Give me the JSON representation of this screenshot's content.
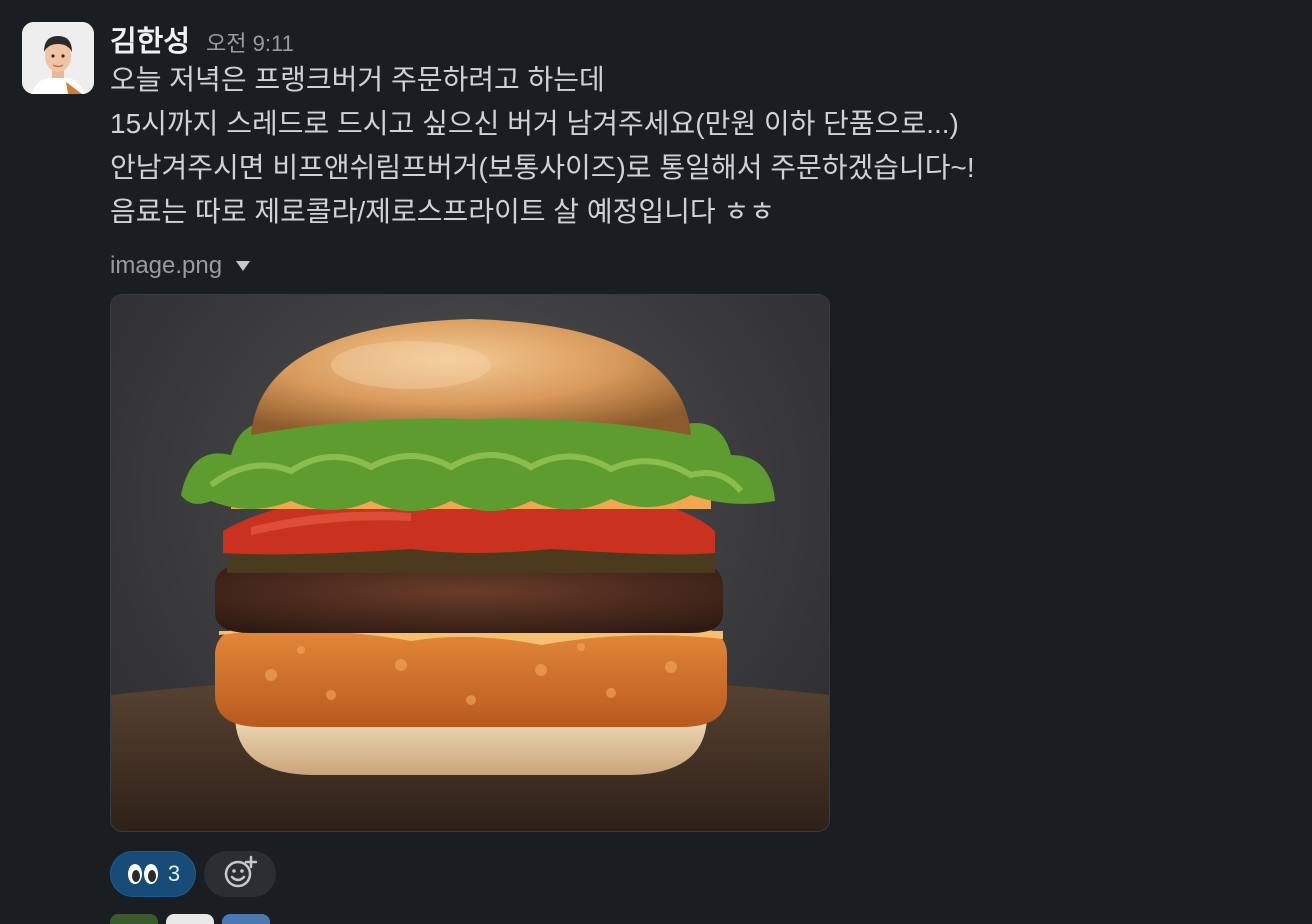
{
  "message": {
    "sender": "김한성",
    "timestamp": "오전 9:11",
    "lines": [
      "오늘 저녁은 프랭크버거 주문하려고 하는데",
      "15시까지 스레드로 드시고 싶으신 버거 남겨주세요(만원 이하 단품으로...)",
      "안남겨주시면 비프앤쉬림프버거(보통사이즈)로 통일해서 주문하겠습니다~!",
      "음료는 따로 제로콜라/제로스프라이트 살 예정입니다 ㅎㅎ"
    ]
  },
  "attachment": {
    "file_name": "image.png",
    "toggle_icon": "caret-down-icon",
    "image_subject": "burger-photo"
  },
  "reactions": [
    {
      "emoji": "eyes",
      "count": "3",
      "selected": true
    }
  ],
  "add_reaction_icon": "add-emoji-icon",
  "thread_avatars": [
    "participant-1",
    "participant-2",
    "participant-3"
  ],
  "colors": {
    "background": "#1a1d21",
    "text": "#d1d2d3",
    "muted": "#9a9b9d",
    "reaction_selected": "#174c78"
  }
}
